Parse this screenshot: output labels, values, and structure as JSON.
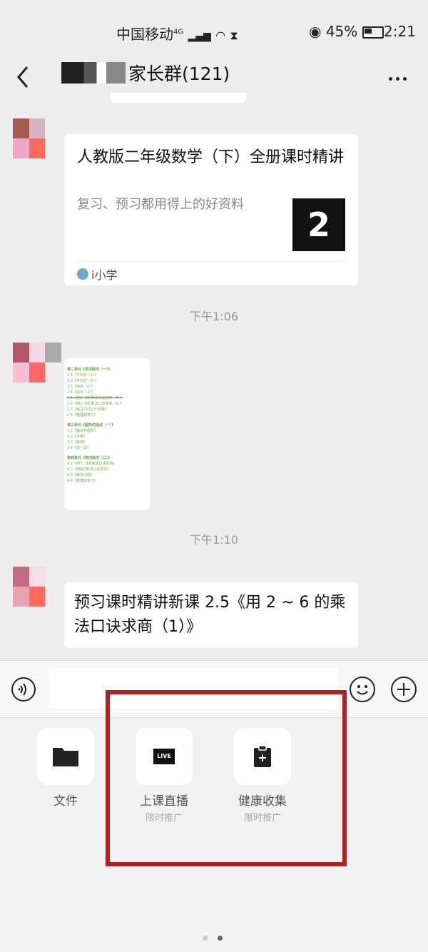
{
  "status": {
    "carrier": "中国移动",
    "network": "4G",
    "battery": "45%",
    "time": "2:21"
  },
  "header": {
    "title": "家长群(121)"
  },
  "messages": {
    "card": {
      "title": "人教版二年级数学（下）全册课时精讲",
      "desc": "复习、预习都用得上的好资料",
      "thumb_text": "2",
      "source": "i小学"
    },
    "time1": "下午1:06",
    "image_doc": {
      "sections": [
        {
          "head": "第二单元《表内除法（一）》",
          "items": [
            "2.1《平均分（1）》",
            "2.2《平均分（2）》",
            "2.3《除法（1）》",
            "2.4《除法（2）》",
            "2.5《用2~6的乘法口诀求商（1）》",
            "2.6《用2~6的乘法口诀求商（2）》",
            "2.7《解决\"平均分\"问题》",
            "2.8《整理和复习》"
          ]
        },
        {
          "head": "第三单元《图形的运动（一）》",
          "items": [
            "3.1《轴对称图形》",
            "3.2《平移》",
            "3.3《旋转》",
            "3.4《剪一剪》"
          ]
        },
        {
          "head": "第四单元《表内除法（二）》",
          "items": [
            "4.1《用7、8的乘法口诀求商》",
            "4.2《用9的乘法口诀求商》",
            "4.3《解决问题》",
            "4.4《整理和复习》"
          ]
        }
      ]
    },
    "time2": "下午1:10",
    "text_msg": "预习课时精讲新课 2.5《用 2 ~ 6 的乘法口诀求商（1）》"
  },
  "input": {
    "value": ""
  },
  "panel": {
    "tools": [
      {
        "label": "文件",
        "sub": ""
      },
      {
        "label": "上课直播",
        "sub": "限时推广",
        "badge": "LIVE"
      },
      {
        "label": "健康收集",
        "sub": "限时推广"
      }
    ]
  },
  "colors": {
    "highlight": "#b51f1f",
    "background": "#ededed"
  }
}
